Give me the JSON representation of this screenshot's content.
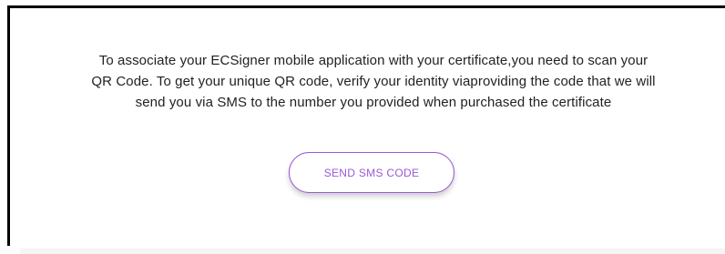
{
  "message": {
    "line1": "To associate your ECSigner mobile application with your certificate,you need to scan your",
    "line2": "QR Code. To get your unique QR code, verify your identity viaproviding the code that we will",
    "line3": "send you via SMS to the number you provided when purchased the certificate"
  },
  "actions": {
    "send_sms_label": "SEND SMS CODE"
  },
  "colors": {
    "accent": "#9b59d4",
    "text": "#222222"
  }
}
